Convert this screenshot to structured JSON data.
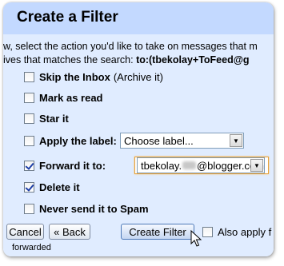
{
  "dialog": {
    "title": "Create a Filter",
    "instruction_line1": "w, select the action you'd like to take on messages that m",
    "instruction_line2_prefix": "ives that matches the search: ",
    "instruction_line2_query": "to:(tbekolay+ToFeed@g"
  },
  "options": [
    {
      "label": "Skip the Inbox",
      "sub": "(Archive it)",
      "checked": false
    },
    {
      "label": "Mark as read",
      "sub": "",
      "checked": false
    },
    {
      "label": "Star it",
      "sub": "",
      "checked": false
    },
    {
      "label": "Apply the label:",
      "sub": "",
      "checked": false
    },
    {
      "label": "Forward it to:",
      "sub": "",
      "checked": true
    },
    {
      "label": "Delete it",
      "sub": "",
      "checked": true
    },
    {
      "label": "Never send it to Spam",
      "sub": "",
      "checked": false
    }
  ],
  "label_select": {
    "value": "Choose label..."
  },
  "forward_select": {
    "value_prefix": "tbekolay.",
    "value_suffix": "@blogger.com"
  },
  "buttons": {
    "cancel": "Cancel",
    "back": "« Back",
    "create": "Create Filter",
    "also_apply": "Also apply f"
  },
  "footer": {
    "text": "forwarded"
  },
  "colors": {
    "header": "#c3d9ff",
    "body": "#e0ecff",
    "focus": "#e8a23b"
  }
}
